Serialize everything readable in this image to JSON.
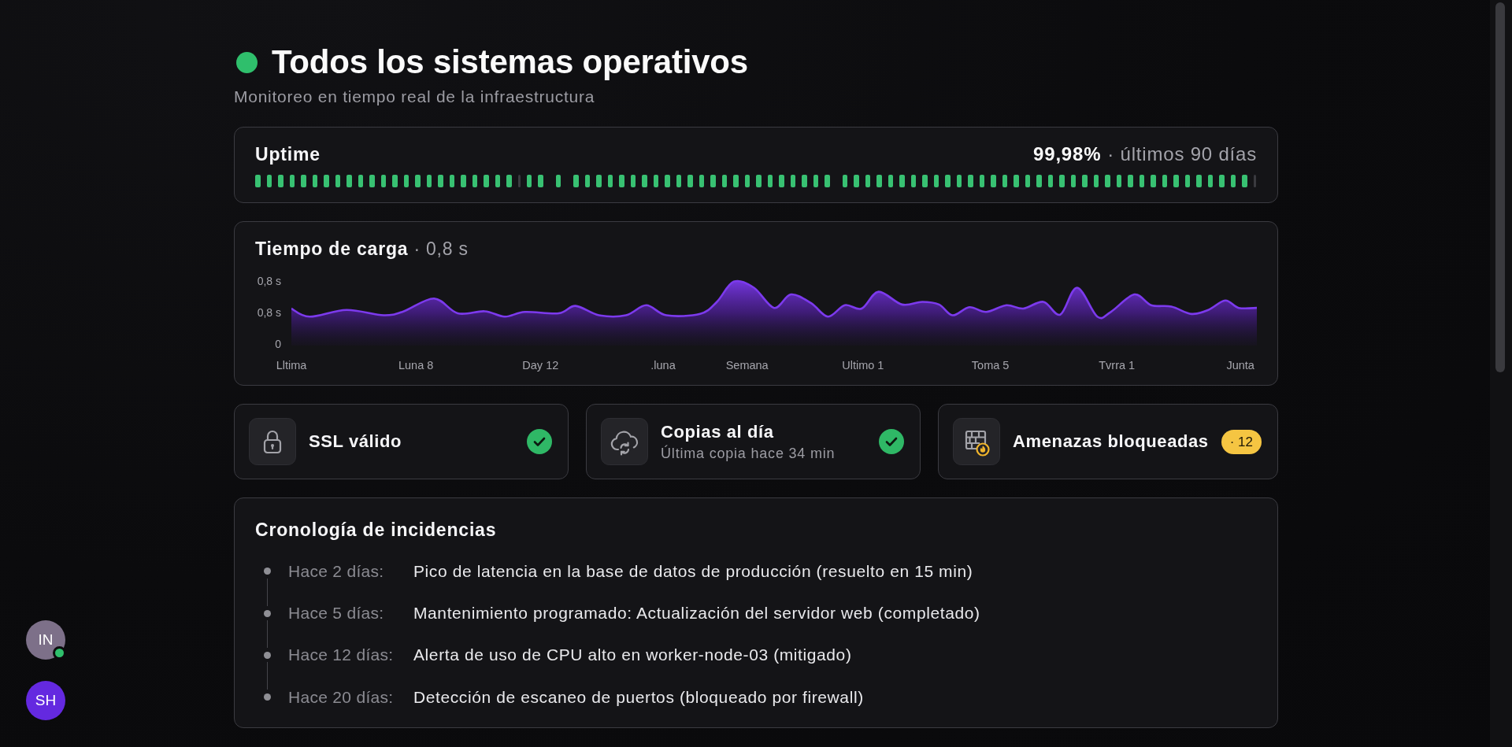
{
  "header": {
    "operational": true,
    "title": "Todos los sistemas operativos",
    "subtitle": "Monitoreo en tiempo real de la infraestructura"
  },
  "uptime": {
    "title": "Uptime",
    "percent": "99,98%",
    "period": "· últimos 90 días",
    "days": [
      {
        "kind": "up"
      },
      {
        "kind": "up"
      },
      {
        "kind": "up"
      },
      {
        "kind": "up"
      },
      {
        "kind": "up"
      },
      {
        "kind": "up"
      },
      {
        "kind": "up"
      },
      {
        "kind": "up"
      },
      {
        "kind": "up"
      },
      {
        "kind": "up"
      },
      {
        "kind": "up"
      },
      {
        "kind": "up"
      },
      {
        "kind": "up"
      },
      {
        "kind": "up"
      },
      {
        "kind": "up"
      },
      {
        "kind": "up"
      },
      {
        "kind": "up"
      },
      {
        "kind": "up"
      },
      {
        "kind": "up"
      },
      {
        "kind": "up"
      },
      {
        "kind": "up"
      },
      {
        "kind": "up"
      },
      {
        "kind": "up"
      },
      {
        "kind": "nodata"
      },
      {
        "kind": "up"
      },
      {
        "kind": "up"
      },
      {
        "kind": "missing"
      },
      {
        "kind": "up"
      },
      {
        "kind": "missing"
      },
      {
        "kind": "up"
      },
      {
        "kind": "up"
      },
      {
        "kind": "up"
      },
      {
        "kind": "up"
      },
      {
        "kind": "up"
      },
      {
        "kind": "up"
      },
      {
        "kind": "up"
      },
      {
        "kind": "up"
      },
      {
        "kind": "up"
      },
      {
        "kind": "up"
      },
      {
        "kind": "up"
      },
      {
        "kind": "up"
      },
      {
        "kind": "up"
      },
      {
        "kind": "up"
      },
      {
        "kind": "up"
      },
      {
        "kind": "up"
      },
      {
        "kind": "up"
      },
      {
        "kind": "up"
      },
      {
        "kind": "up"
      },
      {
        "kind": "up"
      },
      {
        "kind": "up"
      },
      {
        "kind": "up"
      },
      {
        "kind": "up"
      },
      {
        "kind": "missing"
      },
      {
        "kind": "up"
      },
      {
        "kind": "up"
      },
      {
        "kind": "up"
      },
      {
        "kind": "up"
      },
      {
        "kind": "up"
      },
      {
        "kind": "up"
      },
      {
        "kind": "up"
      },
      {
        "kind": "up"
      },
      {
        "kind": "up"
      },
      {
        "kind": "up"
      },
      {
        "kind": "up"
      },
      {
        "kind": "up"
      },
      {
        "kind": "up"
      },
      {
        "kind": "up"
      },
      {
        "kind": "up"
      },
      {
        "kind": "up"
      },
      {
        "kind": "up"
      },
      {
        "kind": "up"
      },
      {
        "kind": "up"
      },
      {
        "kind": "up"
      },
      {
        "kind": "up"
      },
      {
        "kind": "up"
      },
      {
        "kind": "up"
      },
      {
        "kind": "up"
      },
      {
        "kind": "up"
      },
      {
        "kind": "up"
      },
      {
        "kind": "up"
      },
      {
        "kind": "up"
      },
      {
        "kind": "up"
      },
      {
        "kind": "up"
      },
      {
        "kind": "up"
      },
      {
        "kind": "up"
      },
      {
        "kind": "up"
      },
      {
        "kind": "up"
      },
      {
        "kind": "up"
      },
      {
        "kind": "up"
      },
      {
        "kind": "nodata"
      }
    ]
  },
  "load_time": {
    "title": "Tiempo de carga",
    "value": "· 0,8 s",
    "y_labels": [
      "0,8 s",
      "0,8 s",
      "0"
    ],
    "x_labels": [
      "Lltima",
      "Luna 8",
      "Day 12",
      ".luna",
      "Semana",
      "Ultimo 1",
      "Toma 5",
      "Tvrra 1",
      "Junta"
    ]
  },
  "checks": [
    {
      "kind": "check",
      "title": "SSL válido",
      "ok": true
    },
    {
      "kind": "check",
      "title": "Copias al día",
      "subtitle": "Última copia hace 34 min",
      "ok": true
    },
    {
      "kind": "count",
      "title": "Amenazas bloqueadas",
      "badge": "· 12"
    }
  ],
  "timeline": {
    "title": "Cronología de incidencias",
    "events": [
      {
        "time": "Hace 2 días:",
        "text": "Pico de latencia en la base de datos de producción (resuelto en 15 min)"
      },
      {
        "time": "Hace 5 días:",
        "text": "Mantenimiento programado: Actualización del servidor web (completado)"
      },
      {
        "time": "Hace 12 días:",
        "text": "Alerta de uso de CPU alto en worker-node-03 (mitigado)"
      },
      {
        "time": "Hace 20 días:",
        "text": "Detección de escaneo de puertos (bloqueado por firewall)"
      }
    ]
  },
  "presence": [
    {
      "initials": "IN",
      "color": "#7d7089",
      "online": true
    },
    {
      "initials": "SH",
      "color": "#6429e0",
      "online": false
    }
  ]
}
